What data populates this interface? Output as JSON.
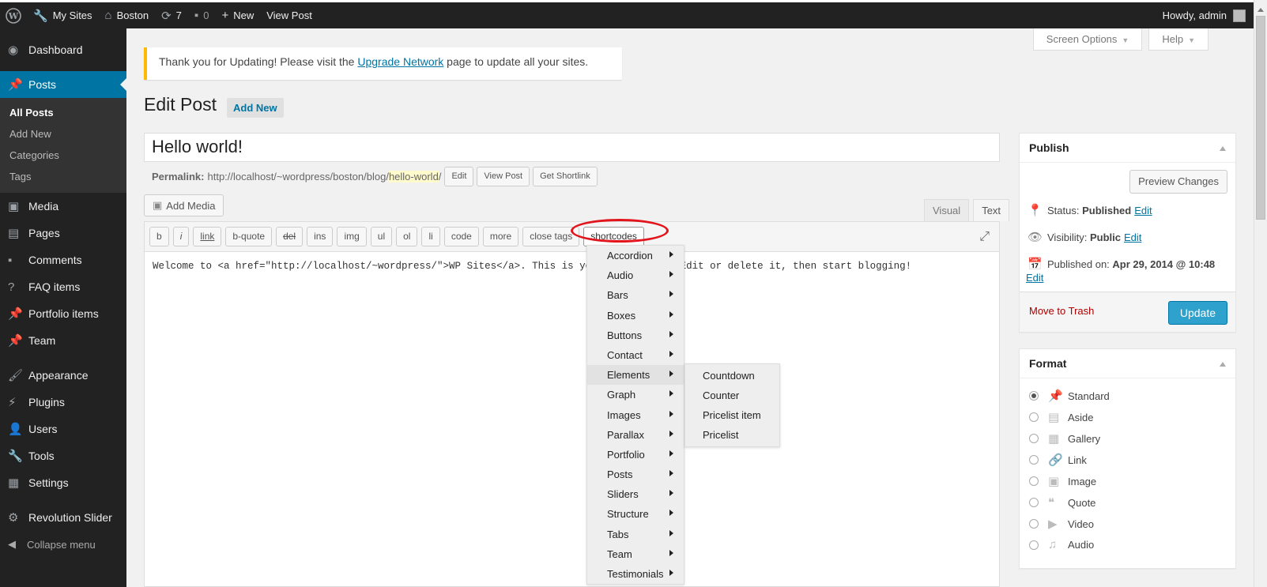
{
  "adminbar": {
    "wp_logo": "wordpress-logo-icon",
    "my_sites": "My Sites",
    "site": "Boston",
    "updates": "7",
    "comments": "0",
    "new": "New",
    "view_post": "View Post",
    "howdy": "Howdy, admin"
  },
  "sidebar": {
    "dashboard": "Dashboard",
    "posts": "Posts",
    "posts_sub": [
      "All Posts",
      "Add New",
      "Categories",
      "Tags"
    ],
    "media": "Media",
    "pages": "Pages",
    "comments": "Comments",
    "faq": "FAQ items",
    "portfolio": "Portfolio items",
    "team": "Team",
    "appearance": "Appearance",
    "plugins": "Plugins",
    "users": "Users",
    "tools": "Tools",
    "settings": "Settings",
    "revslider": "Revolution Slider",
    "collapse": "Collapse menu"
  },
  "screen_options": "Screen Options",
  "help": "Help",
  "notice": {
    "before": "Thank you for Updating! Please visit the ",
    "link": "Upgrade Network",
    "after": " page to update all your sites."
  },
  "page_title": "Edit Post",
  "add_new": "Add New",
  "post_title": "Hello world!",
  "permalink": {
    "label": "Permalink:",
    "base": "http://localhost/~wordpress/boston/blog/",
    "slug": "hello-world",
    "trail": "/",
    "edit": "Edit",
    "view_post": "View Post",
    "shortlink": "Get Shortlink"
  },
  "add_media": "Add Media",
  "editor_tabs": {
    "visual": "Visual",
    "text": "Text"
  },
  "quicktags": [
    "b",
    "i",
    "link",
    "b-quote",
    "del",
    "ins",
    "img",
    "ul",
    "ol",
    "li",
    "code",
    "more",
    "close tags",
    "shortcodes"
  ],
  "editor_content": "Welcome to <a href=\"http://localhost/~wordpress/\">WP Sites</a>. This is your first post. Edit or delete it, then start blogging!",
  "shortcode_menu": [
    "Accordion",
    "Audio",
    "Bars",
    "Boxes",
    "Buttons",
    "Contact",
    "Elements",
    "Graph",
    "Images",
    "Parallax",
    "Portfolio",
    "Posts",
    "Sliders",
    "Structure",
    "Tabs",
    "Team",
    "Testimonials"
  ],
  "elements_submenu": [
    "Countdown",
    "Counter",
    "Pricelist item",
    "Pricelist"
  ],
  "publish": {
    "title": "Publish",
    "preview": "Preview Changes",
    "status_label": "Status:",
    "status_value": "Published",
    "visibility_label": "Visibility:",
    "visibility_value": "Public",
    "published_on_label": "Published on:",
    "published_on_value": "Apr 29, 2014 @ 10:48",
    "edit": "Edit",
    "trash": "Move to Trash",
    "update": "Update"
  },
  "format": {
    "title": "Format",
    "options": [
      "Standard",
      "Aside",
      "Gallery",
      "Link",
      "Image",
      "Quote",
      "Video",
      "Audio"
    ],
    "selected": "Standard"
  },
  "colors": {
    "accent": "#0074a2",
    "highlight": "#e2141c",
    "notice": "#ffba00"
  }
}
